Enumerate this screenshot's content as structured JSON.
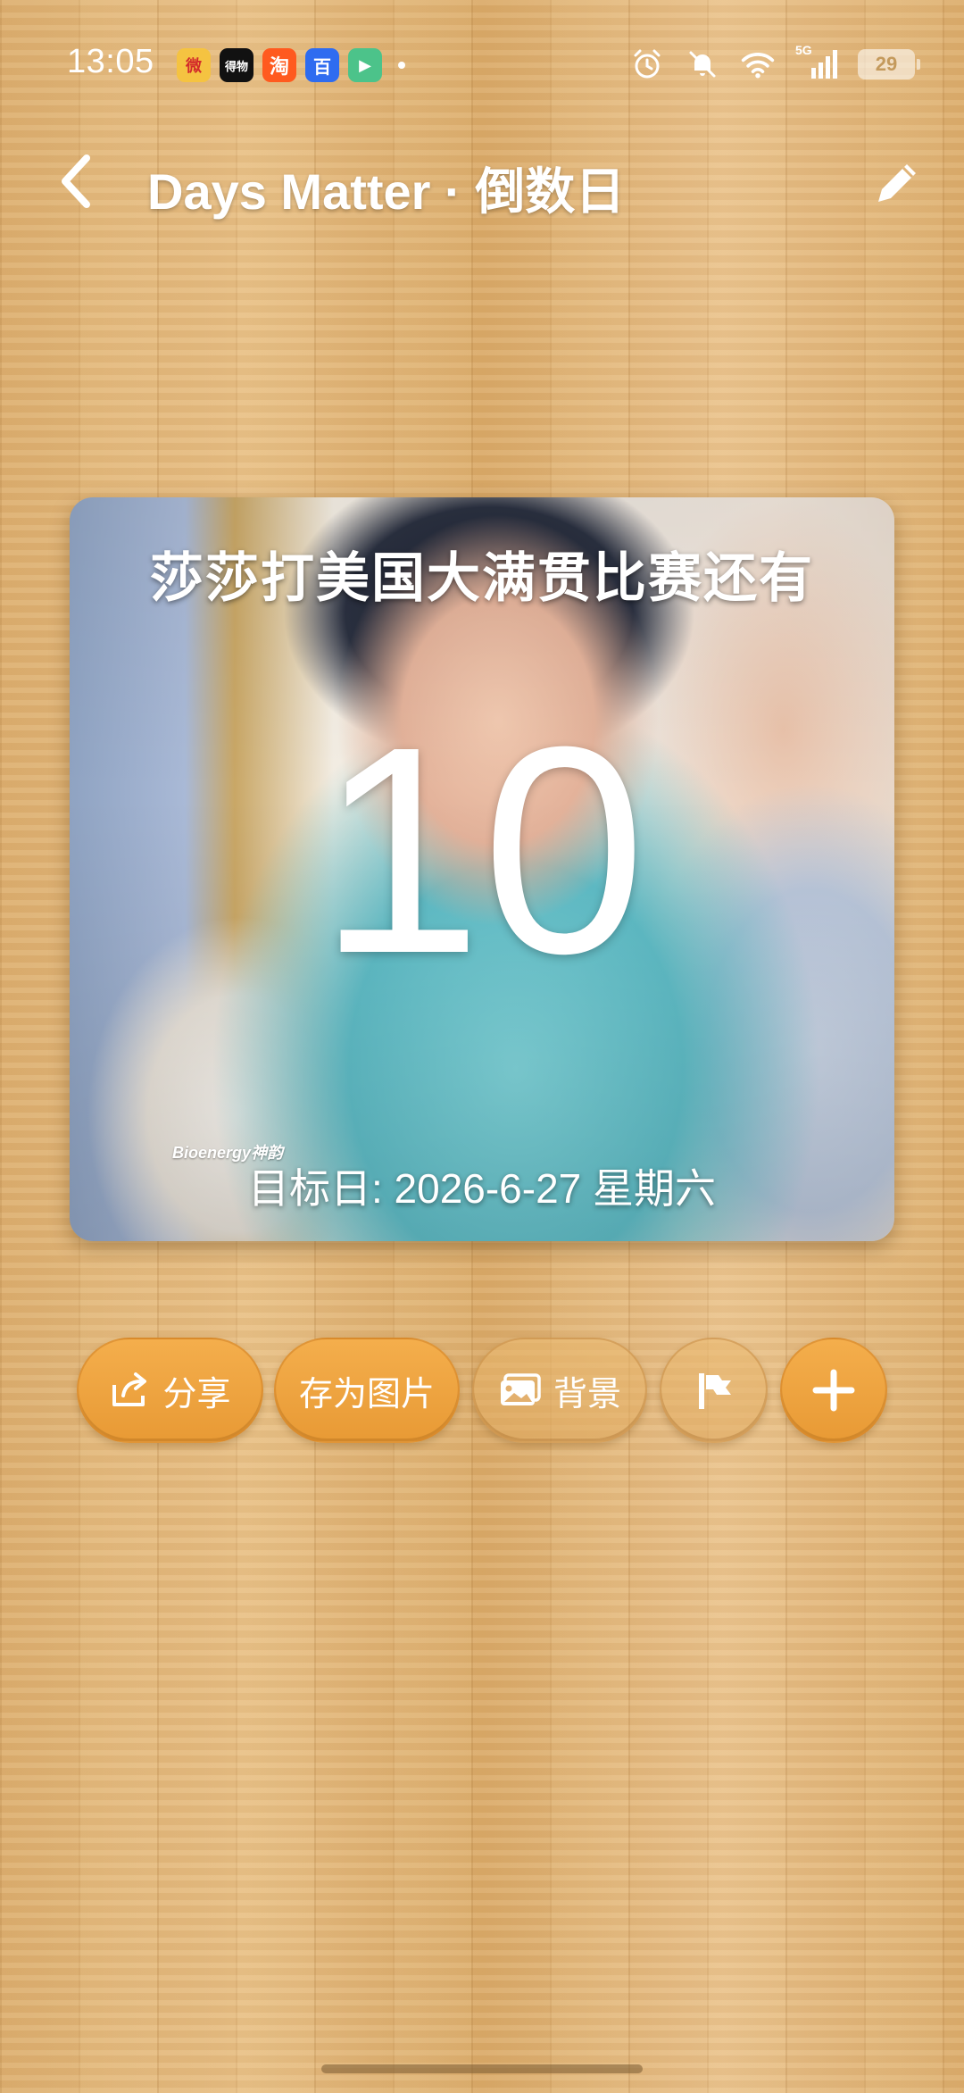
{
  "status_bar": {
    "time": "13:05",
    "network": "5G",
    "battery": "29",
    "notifications": [
      {
        "icon": "weibo-icon",
        "glyph": "微"
      },
      {
        "icon": "dewu-icon",
        "glyph": "得物"
      },
      {
        "icon": "taobao-icon",
        "glyph": "淘"
      },
      {
        "icon": "baidu-icon",
        "glyph": "百"
      },
      {
        "icon": "video-app-icon",
        "glyph": "▶"
      }
    ]
  },
  "header": {
    "title": "Days Matter · 倒数日"
  },
  "card": {
    "title": "莎莎打美国大满贯比赛还有",
    "days": "10",
    "target": "目标日: 2026-6-27 星期六",
    "watermark": "Bioenergy神韵"
  },
  "actions": {
    "share": "分享",
    "save_image": "存为图片",
    "background": "背景"
  },
  "colors": {
    "accent": "#ee9f3a",
    "wood": "#e0b478"
  }
}
